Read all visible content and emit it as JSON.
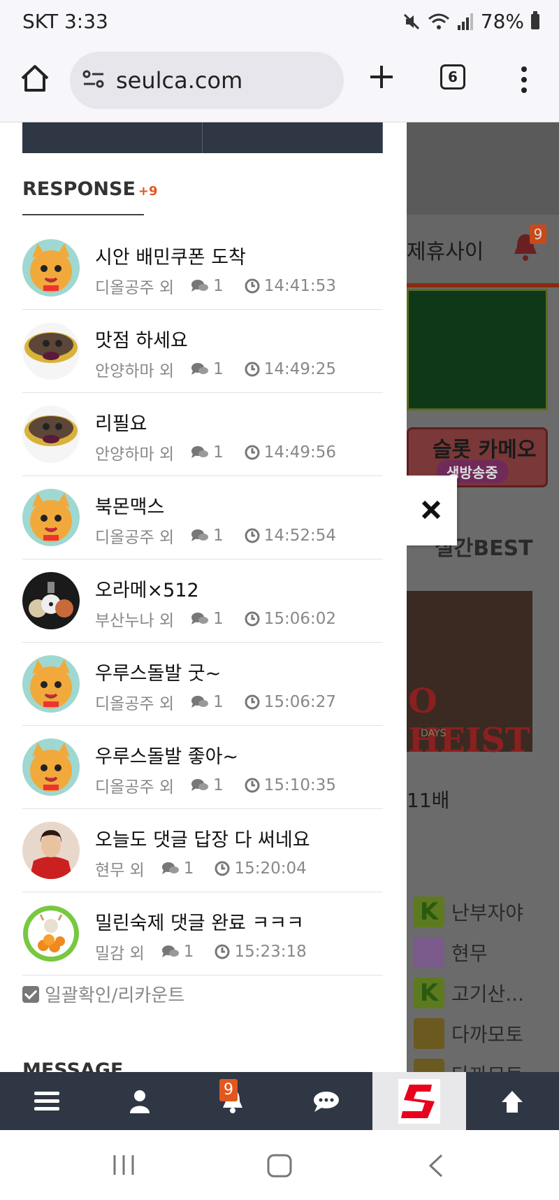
{
  "status_bar": {
    "carrier_time": "SKT 3:33",
    "battery": "78%"
  },
  "browser": {
    "url": "seulca.com",
    "tab_count": "6"
  },
  "background_page": {
    "nav_text": "제휴사이",
    "bell_badge": "9",
    "banner_text": "슬롯 카메오",
    "banner_sub": "생방송중",
    "best_label": "실간BEST",
    "image_text": "O HEIST",
    "image_sub": "DAYS",
    "multiplier": "11배",
    "users": [
      "난부자야",
      "현무",
      "고기산...",
      "다까모토",
      "다까모토"
    ]
  },
  "panel": {
    "response_title": "RESPONSE",
    "response_count": "+9",
    "items": [
      {
        "title": "시안 배민쿠폰 도착",
        "author": "디올공주 외",
        "count": "1",
        "time": "14:41:53",
        "avatar": "cat-avatar"
      },
      {
        "title": "맛점 하세요",
        "author": "안양하마 외",
        "count": "1",
        "time": "14:49:25",
        "avatar": "bowl-avatar"
      },
      {
        "title": "리필요",
        "author": "안양하마 외",
        "count": "1",
        "time": "14:49:56",
        "avatar": "bowl-avatar"
      },
      {
        "title": "북몬맥스",
        "author": "디올공주 외",
        "count": "1",
        "time": "14:52:54",
        "avatar": "cat-avatar"
      },
      {
        "title": "오라메×512",
        "author": "부산누나 외",
        "count": "1",
        "time": "15:06:02",
        "avatar": "dogs-avatar"
      },
      {
        "title": "우루스돌발 굿~",
        "author": "디올공주 외",
        "count": "1",
        "time": "15:06:27",
        "avatar": "cat-avatar"
      },
      {
        "title": "우루스돌발 좋아~",
        "author": "디올공주 외",
        "count": "1",
        "time": "15:10:35",
        "avatar": "cat-avatar"
      },
      {
        "title": "오늘도 댓글 답장 다 써네요",
        "author": "현무 외",
        "count": "1",
        "time": "15:20:04",
        "avatar": "woman-avatar"
      },
      {
        "title": "밀린숙제 댓글 완료 ㅋㅋㅋ",
        "author": "밀감 외",
        "count": "1",
        "time": "15:23:18",
        "avatar": "orange-avatar"
      }
    ],
    "confirm_label": "일괄확인/리카운트",
    "message_title": "MESSAGE"
  },
  "bottom_nav": {
    "bell_badge": "9"
  },
  "colors": {
    "accent": "#e2571e",
    "nav_bg": "#2f3744",
    "logo_red": "#e8001c"
  }
}
